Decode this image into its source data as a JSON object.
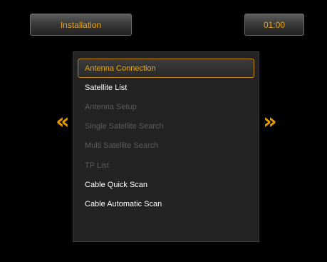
{
  "header": {
    "title": "Installation",
    "time": "01:00"
  },
  "menu": {
    "items": [
      {
        "label": "Antenna Connection",
        "state": "selected"
      },
      {
        "label": "Satellite List",
        "state": "enabled"
      },
      {
        "label": "Antenna Setup",
        "state": "disabled"
      },
      {
        "label": "Single Satellite Search",
        "state": "disabled"
      },
      {
        "label": "Multi Satellite Search",
        "state": "disabled"
      },
      {
        "label": "TP List",
        "state": "disabled"
      },
      {
        "label": "Cable Quick Scan",
        "state": "enabled"
      },
      {
        "label": "Cable Automatic Scan",
        "state": "enabled"
      }
    ]
  },
  "nav": {
    "left_glyph": "«",
    "right_glyph": "»",
    "left_icon": "double-chevron-left-icon",
    "right_icon": "double-chevron-right-icon"
  },
  "colors": {
    "accent": "#f0a800",
    "background": "#000000",
    "panel": "#232323",
    "text": "#ffffff",
    "disabled_text": "#5c5c5c"
  }
}
